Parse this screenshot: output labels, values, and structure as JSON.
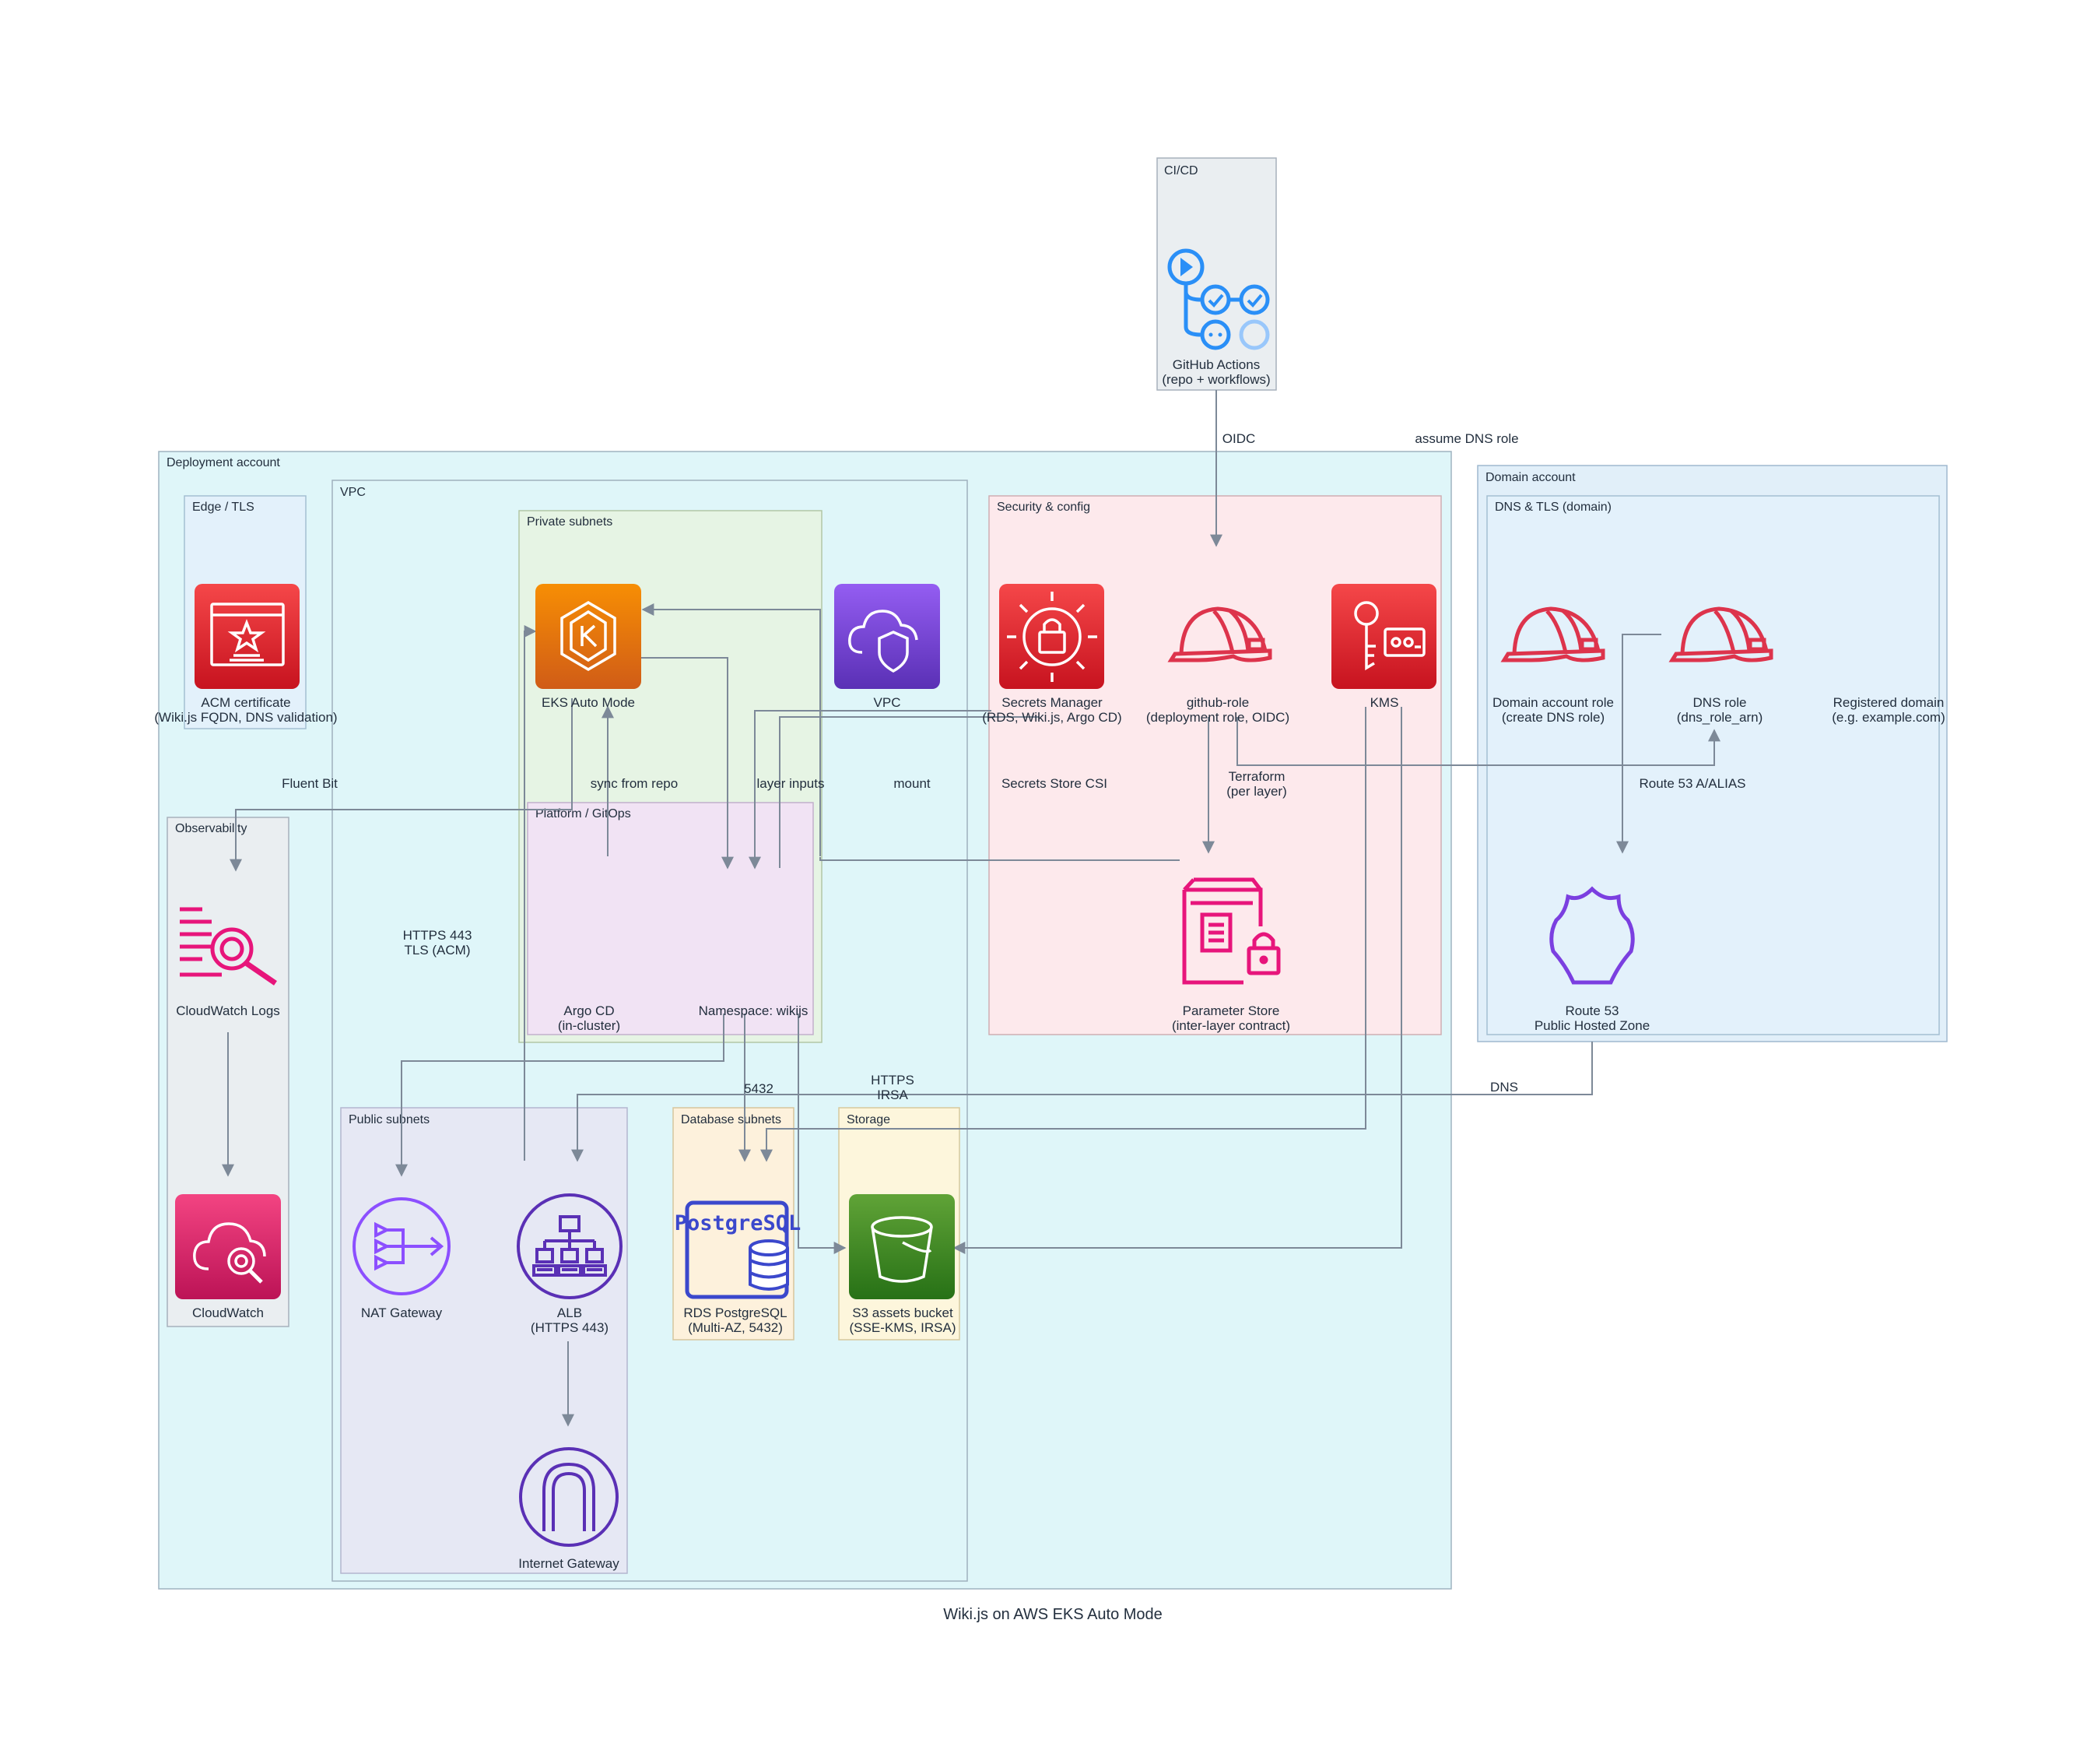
{
  "title": "Wiki.js on AWS EKS Auto Mode",
  "clusters": {
    "cicd": "CI/CD",
    "deployment": "Deployment account",
    "domain": "Domain account",
    "vpc": "VPC",
    "edge": "Edge / TLS",
    "private_subnets": "Private subnets",
    "platform": "Platform / GitOps",
    "security": "Security & config",
    "dns_tls": "DNS & TLS (domain)",
    "observability": "Observability",
    "public_subnets": "Public subnets",
    "database_subnets": "Database subnets",
    "storage": "Storage"
  },
  "nodes": {
    "github_actions": [
      "GitHub Actions",
      "(repo + workflows)"
    ],
    "acm": [
      "ACM certificate",
      "(Wiki.js FQDN, DNS validation)"
    ],
    "eks": [
      "EKS Auto Mode"
    ],
    "vpc": [
      "VPC"
    ],
    "secrets_manager": [
      "Secrets Manager",
      "(RDS, Wiki.js, Argo CD)"
    ],
    "github_role": [
      "github-role",
      "(deployment role, OIDC)"
    ],
    "kms": [
      "KMS"
    ],
    "domain_role": [
      "Domain account role",
      "(create DNS role)"
    ],
    "dns_role": [
      "DNS role",
      "(dns_role_arn)"
    ],
    "registered_domain": [
      "Registered domain",
      "(e.g. example.com)"
    ],
    "cloudwatch_logs": [
      "CloudWatch Logs"
    ],
    "argocd": [
      "Argo CD",
      "(in-cluster)"
    ],
    "namespace": [
      "Namespace: wikijs"
    ],
    "parameter_store": [
      "Parameter Store",
      "(inter-layer contract)"
    ],
    "route53": [
      "Route 53",
      "Public Hosted Zone"
    ],
    "cloudwatch": [
      "CloudWatch"
    ],
    "nat": [
      "NAT Gateway"
    ],
    "alb": [
      "ALB",
      "(HTTPS 443)"
    ],
    "rds": [
      "RDS PostgreSQL",
      "(Multi-AZ, 5432)"
    ],
    "s3": [
      "S3 assets bucket",
      "(SSE-KMS, IRSA)"
    ],
    "igw": [
      "Internet Gateway"
    ]
  },
  "edge_labels": {
    "oidc": [
      "OIDC"
    ],
    "assume_dns": [
      "assume DNS role"
    ],
    "fluent_bit": [
      "Fluent Bit"
    ],
    "sync_repo": [
      "sync from repo"
    ],
    "layer_inputs": [
      "layer inputs"
    ],
    "mount": [
      "mount"
    ],
    "secrets_csi": [
      "Secrets Store CSI"
    ],
    "terraform": [
      "Terraform",
      "(per layer)"
    ],
    "r53_alias": [
      "Route 53 A/ALIAS"
    ],
    "https443": [
      "HTTPS 443",
      "TLS (ACM)"
    ],
    "pg5432": [
      "5432"
    ],
    "https_irsa": [
      "HTTPS",
      "IRSA"
    ],
    "dns": [
      "DNS"
    ]
  },
  "icons": {
    "postgres_text": "PostgreSQL"
  },
  "colors": {
    "edge": "#7d8998",
    "security_red": "#dd344c",
    "compute_orange": "#ed7100",
    "network_purple": "#8c4fff",
    "storage_green": "#3f8624",
    "mgmt_pink": "#e7157b",
    "db_blue": "#3b48cc"
  }
}
